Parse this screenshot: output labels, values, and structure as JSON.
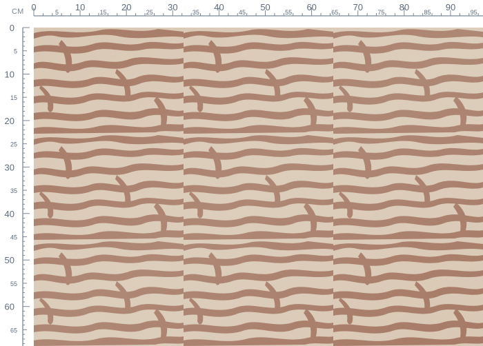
{
  "ruler": {
    "unit": "CM",
    "top_labels": [
      "0",
      "5",
      "10",
      "15",
      "20",
      "25",
      "30",
      "35",
      "40",
      "45",
      "50",
      "55",
      "60",
      "65",
      "70",
      "75",
      "80",
      "85",
      "90",
      "95"
    ],
    "left_labels": [
      "0",
      "5",
      "10",
      "15",
      "20",
      "25",
      "30",
      "35",
      "40",
      "45",
      "50",
      "55",
      "60",
      "65"
    ]
  },
  "fabric": {
    "pattern": "zebra-stripe",
    "colors": {
      "background": "#d9c8b4",
      "stripe": "#a67a66",
      "ruler_line": "#7b8796",
      "ruler_text": "#5d6b7d"
    }
  }
}
